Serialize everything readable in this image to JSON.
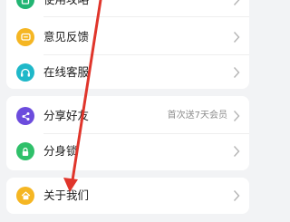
{
  "colors": {
    "page_bg": "#f2f3f5",
    "card_bg": "#ffffff",
    "text": "#1b1b1b",
    "hint_text": "#8d8d8d",
    "chevron": "#b5b5b5",
    "arrow": "#e0352b"
  },
  "menu": {
    "group1": [
      {
        "label": "使用攻略",
        "icon": "guide-icon",
        "color": "#22b573"
      },
      {
        "label": "意见反馈",
        "icon": "feedback-icon",
        "color": "#f5b623"
      },
      {
        "label": "在线客服",
        "icon": "headset-icon",
        "color": "#1fb8c9"
      }
    ],
    "group2": [
      {
        "label": "分享好友",
        "icon": "share-icon",
        "color": "#6c4cdd",
        "hint": "首次送7天会员"
      },
      {
        "label": "分身锁",
        "icon": "lock-icon",
        "color": "#2fc06a"
      }
    ],
    "group3": [
      {
        "label": "关于我们",
        "icon": "home-icon",
        "color": "#f5b623"
      }
    ]
  },
  "annotation": {
    "type": "arrow",
    "color": "#e0352b",
    "target": "关于我们"
  }
}
